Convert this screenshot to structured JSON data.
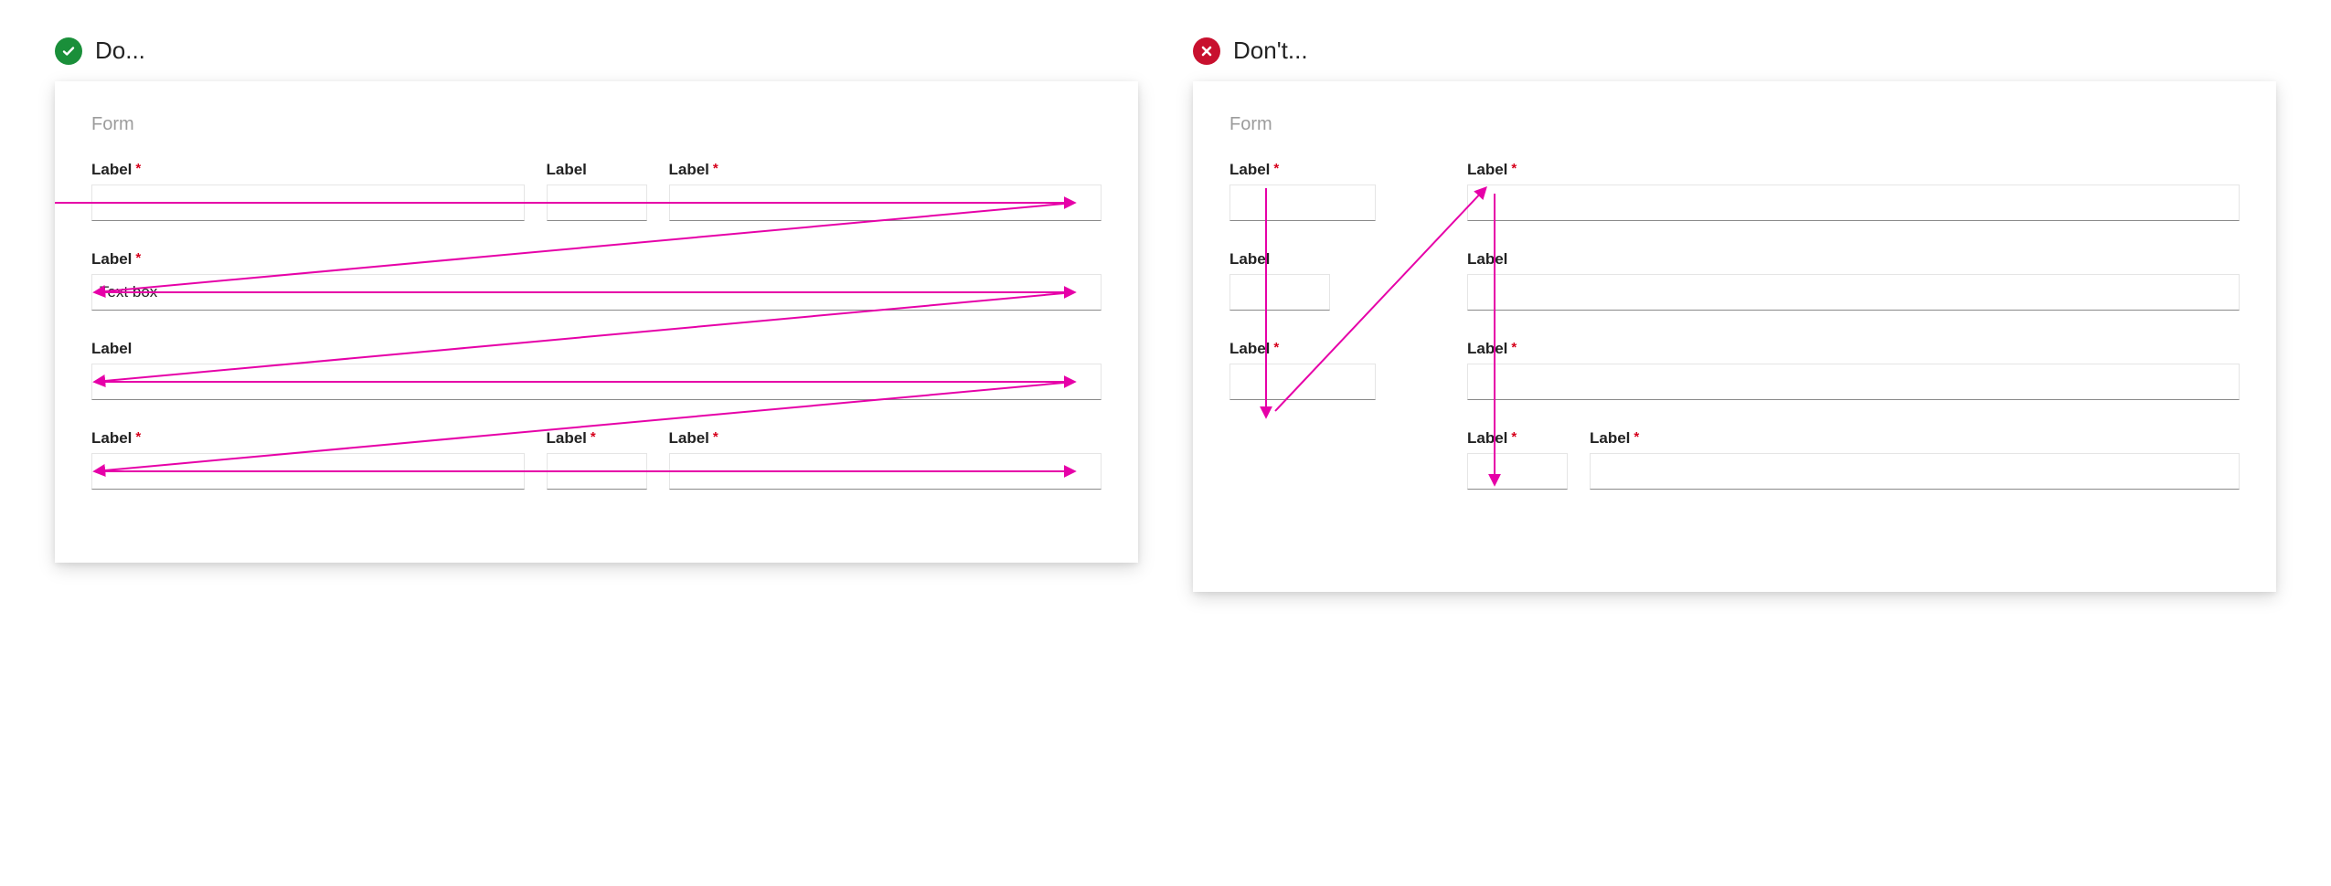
{
  "do": {
    "heading": "Do...",
    "form_title": "Form",
    "rows": [
      [
        {
          "label": "Label",
          "required": true,
          "size": "grow"
        },
        {
          "label": "Label",
          "required": false,
          "size": "sm"
        },
        {
          "label": "Label",
          "required": true,
          "size": "fill"
        }
      ],
      [
        {
          "label": "Label",
          "required": true,
          "size": "grow",
          "value": "Text box"
        }
      ],
      [
        {
          "label": "Label",
          "required": false,
          "size": "grow"
        }
      ],
      [
        {
          "label": "Label",
          "required": true,
          "size": "grow"
        },
        {
          "label": "Label",
          "required": true,
          "size": "sm"
        },
        {
          "label": "Label",
          "required": true,
          "size": "fill"
        }
      ]
    ]
  },
  "dont": {
    "heading": "Don't...",
    "form_title": "Form",
    "colA": [
      {
        "label": "Label",
        "required": true,
        "size": "med"
      },
      {
        "label": "Label",
        "required": false,
        "size": "sm"
      },
      {
        "label": "Label",
        "required": true,
        "size": "med"
      }
    ],
    "colB": [
      {
        "label": "Label",
        "required": true,
        "size": "fill"
      },
      {
        "label": "Label",
        "required": false,
        "size": "fill"
      },
      {
        "label": "Label",
        "required": true,
        "size": "fill"
      },
      {
        "subrow": [
          {
            "label": "Label",
            "required": true,
            "size": "sm"
          },
          {
            "label": "Label",
            "required": true,
            "size": "fill"
          }
        ]
      }
    ]
  },
  "required_marker": "*",
  "colors": {
    "do_icon": "#1a8f3a",
    "dont_icon": "#c8102e",
    "arrow": "#e600a8",
    "required": "#d6001c"
  }
}
